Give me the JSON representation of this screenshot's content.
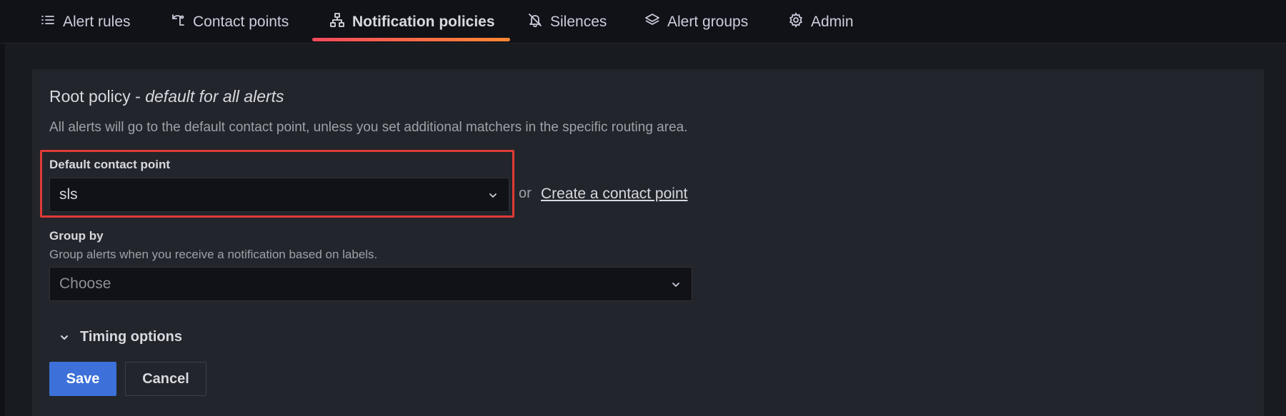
{
  "tabs": [
    {
      "label": "Alert rules",
      "icon": "list-icon"
    },
    {
      "label": "Contact points",
      "icon": "contact-point-icon"
    },
    {
      "label": "Notification policies",
      "icon": "sitemap-icon",
      "active": true
    },
    {
      "label": "Silences",
      "icon": "bell-slash-icon"
    },
    {
      "label": "Alert groups",
      "icon": "layers-icon"
    },
    {
      "label": "Admin",
      "icon": "cog-icon"
    }
  ],
  "root_policy": {
    "title": "Root policy - ",
    "title_emphasis": "default for all alerts",
    "description": "All alerts will go to the default contact point, unless you set additional matchers in the specific routing area."
  },
  "default_contact_point": {
    "label": "Default contact point",
    "value": "sls",
    "or_text": "or",
    "create_link": "Create a contact point"
  },
  "group_by": {
    "label": "Group by",
    "description": "Group alerts when you receive a notification based on labels.",
    "placeholder": "Choose"
  },
  "timing_options": {
    "label": "Timing options"
  },
  "actions": {
    "save": "Save",
    "cancel": "Cancel"
  },
  "colors": {
    "accent": "#f55f3e",
    "primary_button": "#3d71d9",
    "highlight_border": "#e03a36"
  }
}
